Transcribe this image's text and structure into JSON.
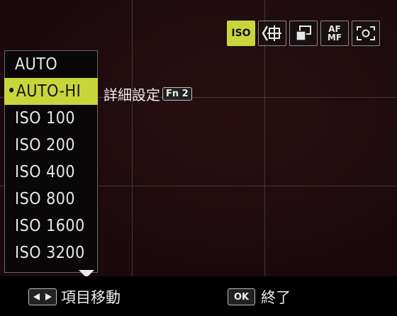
{
  "top_icons": {
    "iso": {
      "label": "ISO"
    },
    "af": {
      "line1": "AF",
      "line2": "MF"
    }
  },
  "iso_menu": {
    "items": [
      "AUTO",
      "•AUTO-HI",
      "ISO 100",
      "ISO 200",
      "ISO 400",
      "ISO 800",
      "ISO 1600",
      "ISO 3200"
    ],
    "selected_index": 1
  },
  "detail": {
    "label": "詳細設定",
    "fn_key": "Fn 2"
  },
  "bottom_bar": {
    "nav_label": "項目移動",
    "ok_key": "OK",
    "ok_label": "終了"
  },
  "colors": {
    "accent": "#c8d63b",
    "background": "#1a0a0c"
  }
}
